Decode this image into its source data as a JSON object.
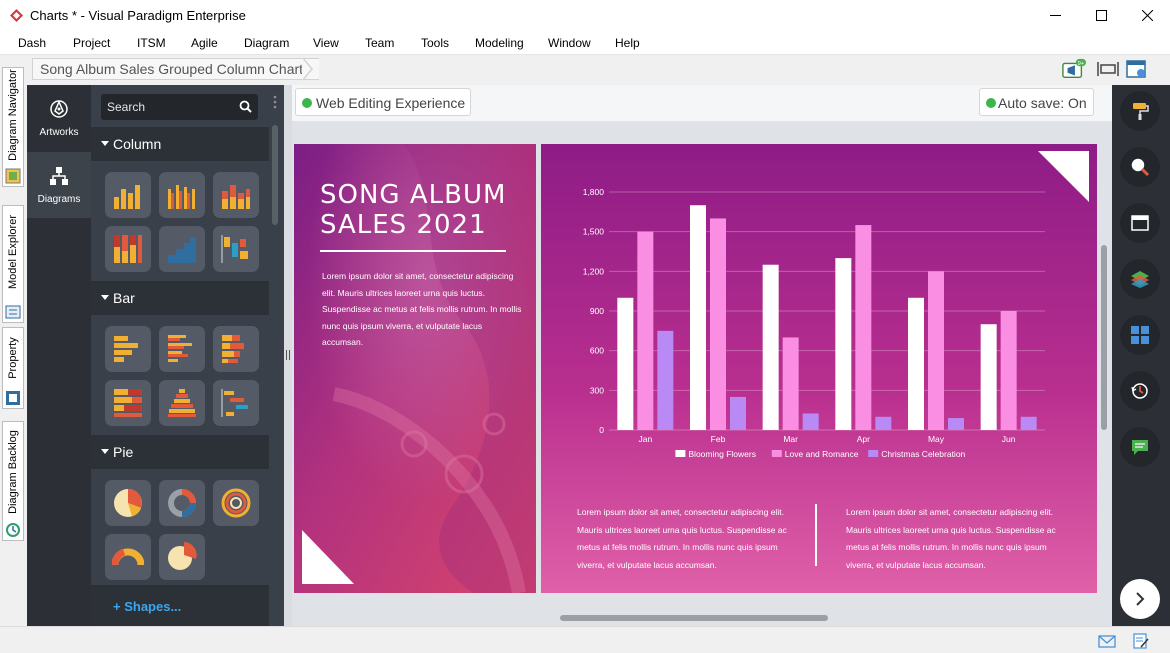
{
  "window": {
    "title": "Charts * - Visual Paradigm Enterprise"
  },
  "menu": [
    "Dash",
    "Project",
    "ITSM",
    "Agile",
    "Diagram",
    "View",
    "Team",
    "Tools",
    "Modeling",
    "Window",
    "Help"
  ],
  "breadcrumb": {
    "label": "Song Album Sales Grouped Column Chart"
  },
  "toolbar": {
    "notification_badge": "9+"
  },
  "left_tabs": [
    "Diagram Navigator",
    "Model Explorer",
    "Property",
    "Diagram Backlog"
  ],
  "rail": {
    "artworks_label": "Artworks",
    "diagrams_label": "Diagrams"
  },
  "shapes_panel": {
    "search_placeholder": "Search",
    "categories": [
      "Column",
      "Bar",
      "Pie"
    ],
    "shapes_link": "+ Shapes..."
  },
  "canvas": {
    "web_editing_label": "Web Editing Experience",
    "autosave_label": "Auto save: On",
    "status_color": "#3cb54a"
  },
  "infographic": {
    "title": "SONG ALBUM SALES 2021",
    "body": "Lorem ipsum dolor sit amet, consectetur adipiscing elit. Mauris ultrices laoreet urna quis luctus. Suspendisse ac metus at felis mollis rutrum. In mollis nunc quis ipsum viverra, et vulputate lacus accumsan.",
    "footer_left": "Lorem ipsum dolor sit amet, consectetur adipiscing elit. Mauris ultrices laoreet urna quis luctus. Suspendisse ac metus at felis mollis rutrum. In mollis nunc quis ipsum viverra, et vulputate lacus accumsan.",
    "footer_right": "Lorem ipsum dolor sit amet, consectetur adipiscing elit. Mauris ultrices laoreet urna quis luctus. Suspendisse ac metus at felis mollis rutrum. In mollis nunc quis ipsum viverra, et vulputate lacus accumsan."
  },
  "chart_data": {
    "type": "bar",
    "title": "",
    "xlabel": "",
    "ylabel": "",
    "categories": [
      "Jan",
      "Feb",
      "Mar",
      "Apr",
      "May",
      "Jun"
    ],
    "ylim": [
      0,
      1800
    ],
    "yticks": [
      "0",
      "300",
      "600",
      "900",
      "1,200",
      "1,500",
      "1,800"
    ],
    "ytick_values": [
      0,
      300,
      600,
      900,
      1200,
      1500,
      1800
    ],
    "grid": true,
    "legend_position": "bottom",
    "series": [
      {
        "name": "Blooming Flowers",
        "color": "#ffffff",
        "values": [
          1000,
          1700,
          1250,
          1300,
          1000,
          800
        ]
      },
      {
        "name": "Love and Romance",
        "color": "#f98ee3",
        "values": [
          1500,
          1600,
          700,
          1550,
          1200,
          900
        ]
      },
      {
        "name": "Christmas Celebration",
        "color": "#b98af5",
        "values": [
          750,
          250,
          125,
          100,
          90,
          100
        ]
      }
    ]
  }
}
